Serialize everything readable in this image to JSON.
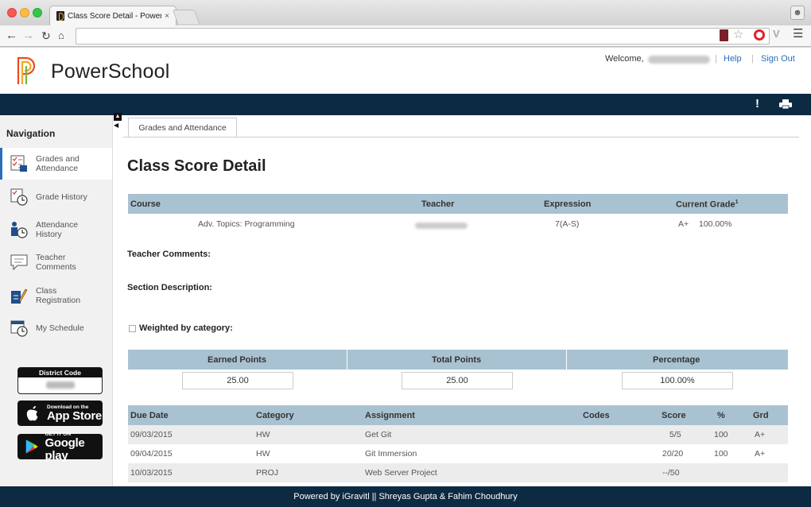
{
  "browser": {
    "tab_title": "Class Score Detail - Power",
    "tab_close": "×",
    "url": ""
  },
  "header": {
    "brand": "PowerSchool",
    "welcome": "Welcome,",
    "separator": "|",
    "help": "Help",
    "sign_out": "Sign Out"
  },
  "sidebar": {
    "title": "Navigation",
    "items": [
      {
        "label": "Grades and Attendance",
        "active": true
      },
      {
        "label": "Grade History"
      },
      {
        "label": "Attendance History"
      },
      {
        "label": "Teacher Comments"
      },
      {
        "label": "Class Registration"
      },
      {
        "label": "My Schedule"
      }
    ],
    "district_code_label": "District Code",
    "appstore": {
      "small": "Download on the",
      "big": "App Store"
    },
    "googleplay": {
      "small": "GET IT ON",
      "big": "Google play"
    }
  },
  "content": {
    "tab": "Grades and Attendance",
    "title": "Class Score Detail",
    "course_table": {
      "headers": {
        "course": "Course",
        "teacher": "Teacher",
        "expression": "Expression",
        "current_grade": "Current Grade",
        "current_grade_sup": "1"
      },
      "row": {
        "course": "Adv. Topics: Programming",
        "expression": "7(A-S)",
        "grade": "A+",
        "percent": "100.00%"
      }
    },
    "teacher_comments_label": "Teacher Comments:",
    "section_description_label": "Section Description:",
    "weighted_label": "Weighted by category:",
    "points": {
      "headers": {
        "earned": "Earned Points",
        "total": "Total Points",
        "percentage": "Percentage"
      },
      "values": {
        "earned": "25.00",
        "total": "25.00",
        "percentage": "100.00%"
      }
    },
    "assignments": {
      "headers": {
        "due": "Due Date",
        "category": "Category",
        "assignment": "Assignment",
        "codes": "Codes",
        "score": "Score",
        "pct": "%",
        "grd": "Grd"
      },
      "rows": [
        {
          "due": "09/03/2015",
          "category": "HW",
          "assignment": "Get Git",
          "codes": "",
          "score": "5/5",
          "pct": "100",
          "grd": "A+"
        },
        {
          "due": "09/04/2015",
          "category": "HW",
          "assignment": "Git Immersion",
          "codes": "",
          "score": "20/20",
          "pct": "100",
          "grd": "A+"
        },
        {
          "due": "10/03/2015",
          "category": "PROJ",
          "assignment": "Web Server Project",
          "codes": "",
          "score": "--/50",
          "pct": "",
          "grd": ""
        }
      ]
    }
  },
  "footer": {
    "text": "Powered by iGravitl || Shreyas Gupta & Fahim Choudhury"
  },
  "colors": {
    "navy": "#0d2a43",
    "table_header": "#a9c2d2",
    "link": "#2a6ebb"
  }
}
